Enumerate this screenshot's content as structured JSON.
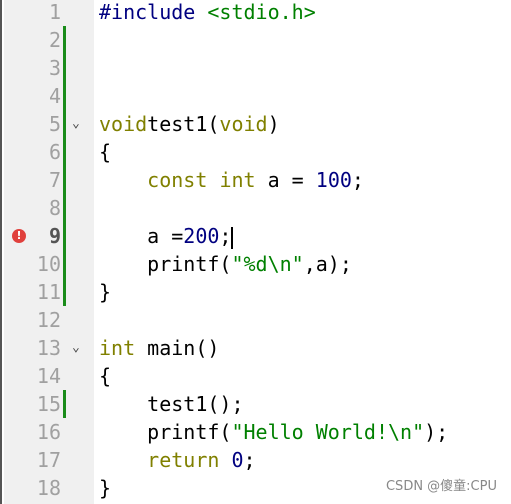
{
  "editor": {
    "lines": [
      {
        "n": "1",
        "tokens": [
          [
            "pp",
            "#include "
          ],
          [
            "inc",
            "<stdio.h>"
          ]
        ]
      },
      {
        "n": "2",
        "tokens": [],
        "changed": true
      },
      {
        "n": "3",
        "tokens": [],
        "changed": true
      },
      {
        "n": "4",
        "tokens": [],
        "changed": true
      },
      {
        "n": "5",
        "tokens": [
          [
            "kw",
            "void"
          ],
          [
            "",
            "test1("
          ],
          [
            "kw",
            "void"
          ],
          [
            "",
            ")"
          ]
        ],
        "changed": true,
        "fold": true
      },
      {
        "n": "6",
        "tokens": [
          [
            "",
            "{"
          ]
        ],
        "changed": true
      },
      {
        "n": "7",
        "tokens": [
          [
            "",
            "    "
          ],
          [
            "kw",
            "const"
          ],
          [
            "",
            " "
          ],
          [
            "kw",
            "int"
          ],
          [
            "",
            " a = "
          ],
          [
            "num2",
            "100"
          ],
          [
            "",
            ";"
          ]
        ],
        "changed": true
      },
      {
        "n": "8",
        "tokens": [],
        "changed": true
      },
      {
        "n": "9",
        "tokens": [
          [
            "",
            "    a ="
          ],
          [
            "num2",
            "200"
          ],
          [
            "",
            ";"
          ]
        ],
        "changed": true,
        "current": true,
        "error": true,
        "caret": true
      },
      {
        "n": "10",
        "tokens": [
          [
            "",
            "    printf("
          ],
          [
            "str",
            "\"%d\\n\""
          ],
          [
            "",
            ",a);"
          ]
        ],
        "changed": true
      },
      {
        "n": "11",
        "tokens": [
          [
            "",
            "}"
          ]
        ],
        "changed": true
      },
      {
        "n": "12",
        "tokens": []
      },
      {
        "n": "13",
        "tokens": [
          [
            "kw",
            "int"
          ],
          [
            "",
            " main()"
          ]
        ],
        "fold": true
      },
      {
        "n": "14",
        "tokens": [
          [
            "",
            "{"
          ]
        ]
      },
      {
        "n": "15",
        "tokens": [
          [
            "",
            "    test1();"
          ]
        ],
        "changed": true
      },
      {
        "n": "16",
        "tokens": [
          [
            "",
            "    printf("
          ],
          [
            "str",
            "\"Hello World!\\n\""
          ],
          [
            "",
            ");"
          ]
        ]
      },
      {
        "n": "17",
        "tokens": [
          [
            "",
            "    "
          ],
          [
            "kw",
            "return"
          ],
          [
            "",
            " "
          ],
          [
            "num2",
            "0"
          ],
          [
            "",
            ";"
          ]
        ]
      },
      {
        "n": "18",
        "tokens": [
          [
            "",
            "}"
          ]
        ]
      }
    ]
  },
  "icons": {
    "fold": "chevron-down-icon",
    "error": "error-icon"
  },
  "colors": {
    "keyword": "#808000",
    "string": "#008000",
    "number": "#000080",
    "change_bar": "#1a8c1a",
    "error": "#e0403c"
  },
  "watermark": "CSDN @傻童:CPU"
}
